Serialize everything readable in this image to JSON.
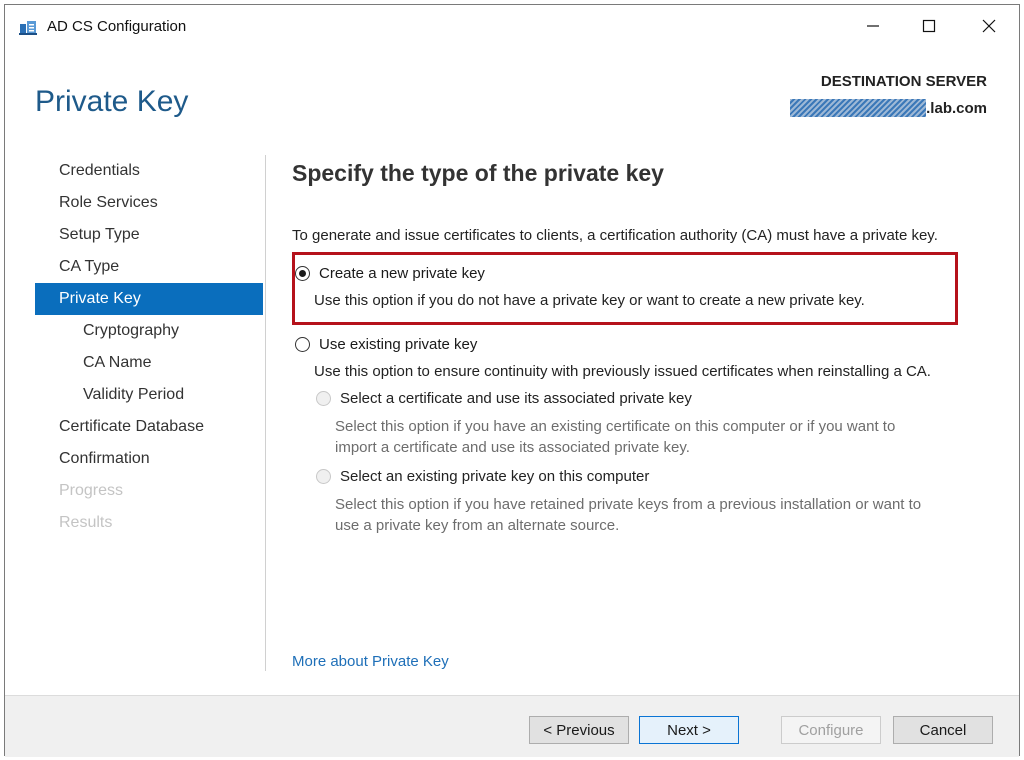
{
  "window": {
    "title": "AD CS Configuration",
    "controls": {
      "minimize": "–",
      "maximize": "☐",
      "close": "✕"
    }
  },
  "header": {
    "page_title": "Private Key",
    "destination_label": "DESTINATION SERVER",
    "destination_server_suffix": ".lab.com"
  },
  "nav": {
    "items": [
      {
        "label": "Credentials",
        "state": "normal"
      },
      {
        "label": "Role Services",
        "state": "normal"
      },
      {
        "label": "Setup Type",
        "state": "normal"
      },
      {
        "label": "CA Type",
        "state": "normal"
      },
      {
        "label": "Private Key",
        "state": "active"
      },
      {
        "label": "Cryptography",
        "state": "sub"
      },
      {
        "label": "CA Name",
        "state": "sub"
      },
      {
        "label": "Validity Period",
        "state": "sub"
      },
      {
        "label": "Certificate Database",
        "state": "normal"
      },
      {
        "label": "Confirmation",
        "state": "normal"
      },
      {
        "label": "Progress",
        "state": "disabled"
      },
      {
        "label": "Results",
        "state": "disabled"
      }
    ]
  },
  "main": {
    "section_title": "Specify the type of the private key",
    "description": "To generate and issue certificates to clients, a certification authority (CA) must have a private key.",
    "option_new": {
      "label": "Create a new private key",
      "description": "Use this option if you do not have a private key or want to create a new private key.",
      "selected": true
    },
    "option_existing": {
      "label": "Use existing private key",
      "description": "Use this option to ensure continuity with previously issued certificates when reinstalling a CA.",
      "selected": false,
      "sub_options": [
        {
          "label": "Select a certificate and use its associated private key",
          "description_line1": "Select this option if you have an existing certificate on this computer or if you want to",
          "description_line2": "import a certificate and use its associated private key."
        },
        {
          "label": "Select an existing private key on this computer",
          "description_line1": "Select this option if you have retained private keys from a previous installation or want to",
          "description_line2": "use a private key from an alternate source."
        }
      ]
    },
    "more_link": "More about Private Key"
  },
  "footer": {
    "previous_label": "< Previous",
    "next_label": "Next >",
    "configure_label": "Configure",
    "cancel_label": "Cancel"
  },
  "colors": {
    "accent": "#0a6ebd",
    "title_blue": "#1e5a8a",
    "highlight_red": "#b5121b",
    "link": "#1e6fb8"
  }
}
